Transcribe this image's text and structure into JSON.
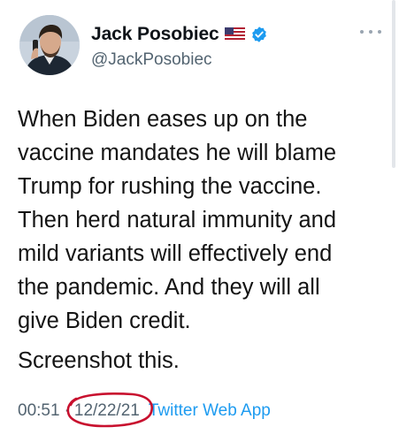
{
  "author": {
    "display_name": "Jack Posobiec",
    "handle": "@JackPosobiec",
    "flag_icon": "us-flag-icon",
    "verified_icon": "verified-badge-icon",
    "verified_color": "#1d9bf0"
  },
  "tweet": {
    "lines": [
      "When Biden eases up on the",
      "vaccine mandates he will blame",
      "Trump for rushing the vaccine.",
      "Then herd natural immunity and",
      "mild variants will effectively end",
      "the pandemic. And they will all",
      "give Biden credit."
    ],
    "closing_line": "Screenshot this."
  },
  "meta": {
    "time": "00:51",
    "separator": "·",
    "date": "12/22/21",
    "source": "Twitter Web App",
    "annotation_color": "#c8102e"
  },
  "colors": {
    "secondary_text": "#536471",
    "link": "#1d9bf0"
  }
}
